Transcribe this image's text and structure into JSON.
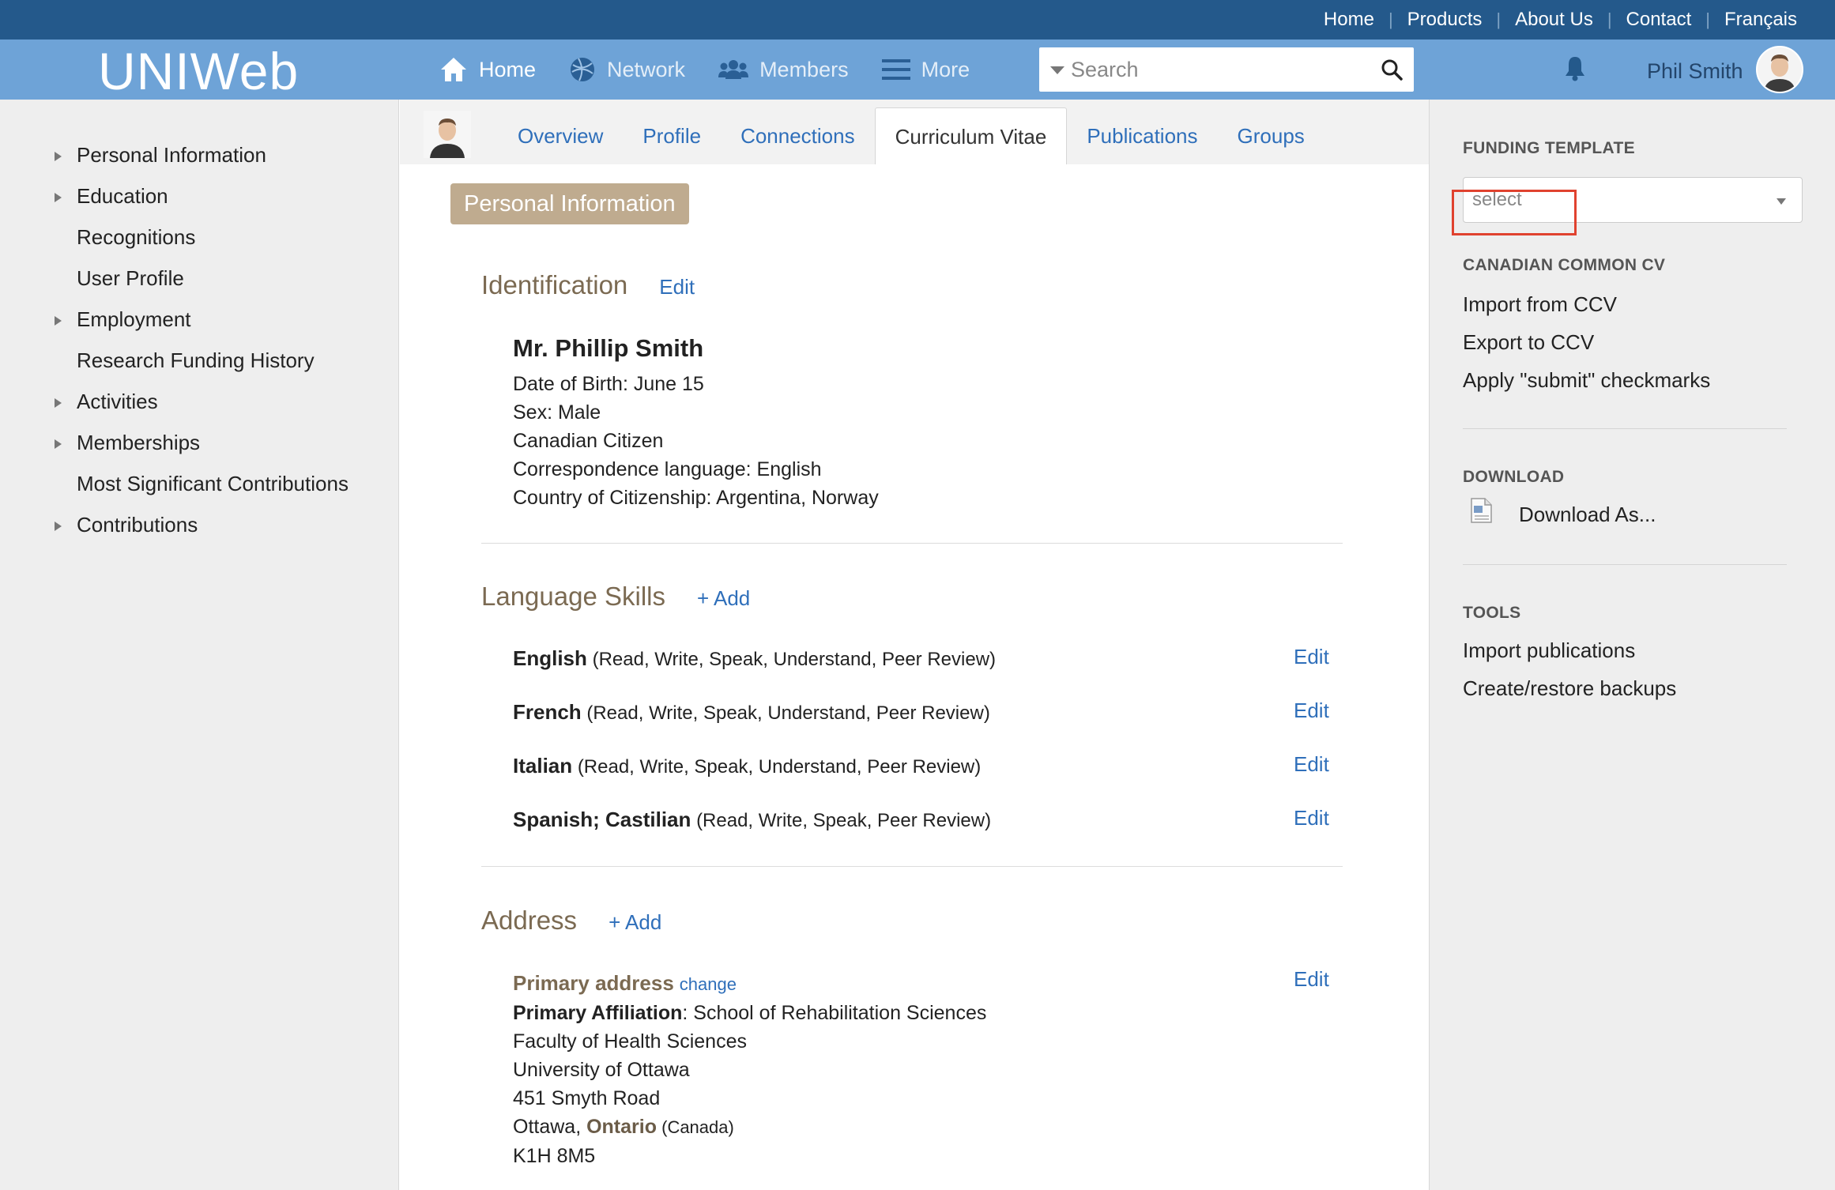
{
  "topbar": {
    "links": [
      "Home",
      "Products",
      "About Us",
      "Contact",
      "Français"
    ]
  },
  "header": {
    "logo": "UNIWeb",
    "nav": {
      "home": "Home",
      "network": "Network",
      "members": "Members",
      "more": "More"
    },
    "search_placeholder": "Search",
    "user_name": "Phil Smith"
  },
  "sidebar": {
    "items": [
      {
        "label": "Personal Information",
        "expandable": true
      },
      {
        "label": "Education",
        "expandable": true
      },
      {
        "label": "Recognitions",
        "expandable": false
      },
      {
        "label": "User Profile",
        "expandable": false
      },
      {
        "label": "Employment",
        "expandable": true
      },
      {
        "label": "Research Funding History",
        "expandable": false
      },
      {
        "label": "Activities",
        "expandable": true
      },
      {
        "label": "Memberships",
        "expandable": true
      },
      {
        "label": "Most Significant Contributions",
        "expandable": false
      },
      {
        "label": "Contributions",
        "expandable": true
      }
    ]
  },
  "tabs": [
    {
      "label": "Overview",
      "active": false
    },
    {
      "label": "Profile",
      "active": false
    },
    {
      "label": "Connections",
      "active": false
    },
    {
      "label": "Curriculum Vitae",
      "active": true
    },
    {
      "label": "Publications",
      "active": false
    },
    {
      "label": "Groups",
      "active": false
    }
  ],
  "main": {
    "section_pill": "Personal Information",
    "identification": {
      "title": "Identification",
      "edit": "Edit",
      "name": "Mr. Phillip Smith",
      "lines": [
        "Date of Birth: June 15",
        "Sex: Male",
        "Canadian Citizen",
        "Correspondence language: English",
        "Country of Citizenship: Argentina, Norway"
      ]
    },
    "language_skills": {
      "title": "Language Skills",
      "add": "+ Add",
      "edit": "Edit",
      "items": [
        {
          "language": "English",
          "skills": "(Read, Write, Speak, Understand, Peer Review)"
        },
        {
          "language": "French",
          "skills": "(Read, Write, Speak, Understand, Peer Review)"
        },
        {
          "language": "Italian",
          "skills": "(Read, Write, Speak, Understand, Peer Review)"
        },
        {
          "language": "Spanish; Castilian",
          "skills": "(Read, Write, Speak, Peer Review)"
        }
      ]
    },
    "address": {
      "title": "Address",
      "add": "+ Add",
      "edit": "Edit",
      "primary_label": "Primary address",
      "change": "change",
      "affiliation_label": "Primary Affiliation",
      "affiliation_value": ": School of Rehabilitation Sciences",
      "line1": "Faculty of Health Sciences",
      "line2": "University of Ottawa",
      "line3": "451 Smyth Road",
      "city": "Ottawa, ",
      "province": "Ontario",
      "country": " (Canada)",
      "postal": "K1H 8M5"
    }
  },
  "rightbar": {
    "funding_heading": "FUNDING TEMPLATE",
    "select_value": "select",
    "ccv_heading": "CANADIAN COMMON CV",
    "import_ccv": "Import from CCV",
    "export_ccv": "Export to CCV",
    "apply_checkmarks": "Apply \"submit\" checkmarks",
    "download_heading": "DOWNLOAD",
    "download_as": "Download As...",
    "tools_heading": "TOOLS",
    "import_publications": "Import publications",
    "backups": "Create/restore backups"
  },
  "colors": {
    "topbar": "#24598b",
    "header": "#6ea3d7",
    "link": "#2f6fba",
    "section_title": "#7b6a52",
    "pill": "#bfab8f",
    "highlight": "#e0422f"
  }
}
